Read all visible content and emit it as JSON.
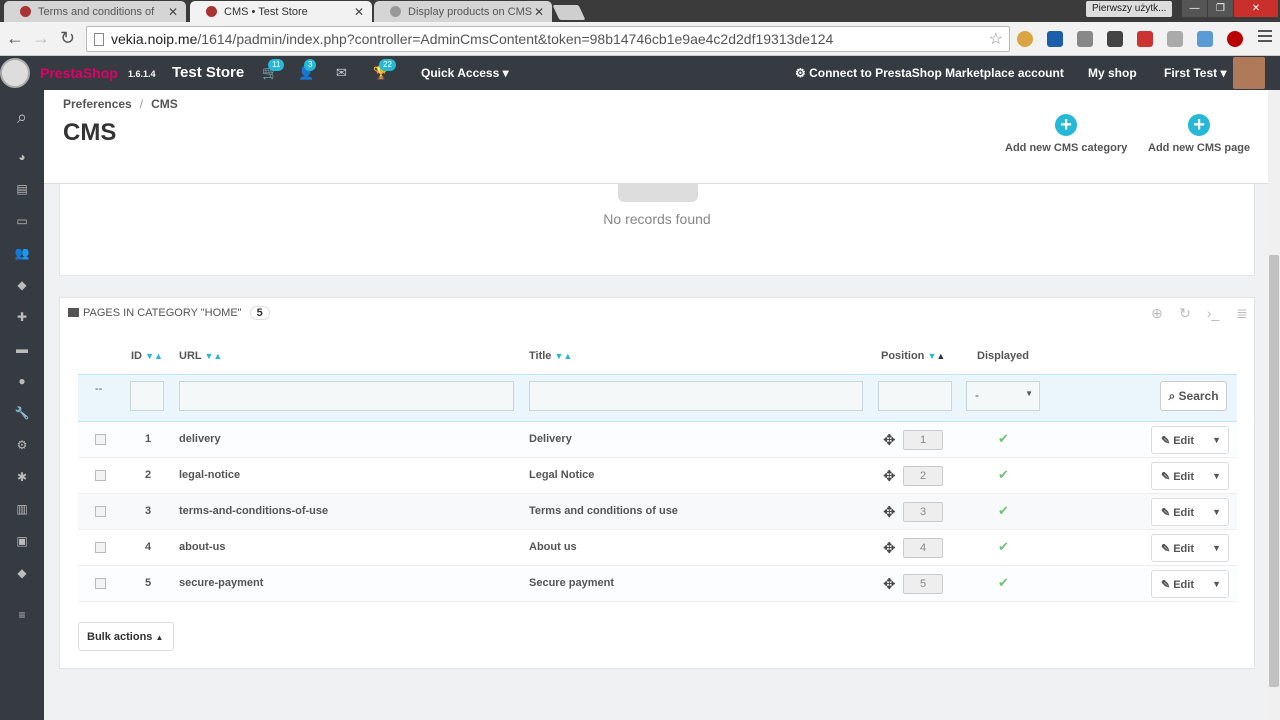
{
  "browser": {
    "tabs": [
      {
        "title": "Terms and conditions of "
      },
      {
        "title": "CMS • Test Store"
      },
      {
        "title": "Display products on CMS"
      }
    ],
    "window_user": "Pierwszy użytk...",
    "url_host": "vekia.noip.me",
    "url_path": "/1614/padmin/index.php?controller=AdminCmsContent&token=98b14746cb1e9ae4c2d2df19313de124"
  },
  "header": {
    "brand_a": "Presta",
    "brand_b": "Shop",
    "version": "1.6.1.4",
    "store": "Test Store",
    "badges": {
      "orders": "11",
      "customers": "3",
      "messages": "22"
    },
    "quick_access": "Quick Access",
    "marketplace": "Connect to PrestaShop Marketplace account",
    "my_shop": "My shop",
    "user": "First Test"
  },
  "page": {
    "breadcrumb": [
      "Preferences",
      "CMS"
    ],
    "title": "CMS",
    "toolbar": {
      "add_category": "Add new CMS category",
      "add_page": "Add new CMS page"
    }
  },
  "categories_panel": {
    "empty": "No records found"
  },
  "pages_panel": {
    "heading": "Pages in category \"Home\"",
    "count": "5",
    "columns": {
      "id": "ID",
      "url": "URL",
      "title": "Title",
      "position": "Position",
      "displayed": "Displayed"
    },
    "filter": {
      "dash": "--",
      "displayed_value": "-",
      "search": "Search"
    },
    "rows": [
      {
        "id": "1",
        "url": "delivery",
        "title": "Delivery",
        "position": "1"
      },
      {
        "id": "2",
        "url": "legal-notice",
        "title": "Legal Notice",
        "position": "2"
      },
      {
        "id": "3",
        "url": "terms-and-conditions-of-use",
        "title": "Terms and conditions of use",
        "position": "3"
      },
      {
        "id": "4",
        "url": "about-us",
        "title": "About us",
        "position": "4"
      },
      {
        "id": "5",
        "url": "secure-payment",
        "title": "Secure payment",
        "position": "5"
      }
    ],
    "edit_label": "Edit",
    "bulk_actions": "Bulk actions"
  }
}
